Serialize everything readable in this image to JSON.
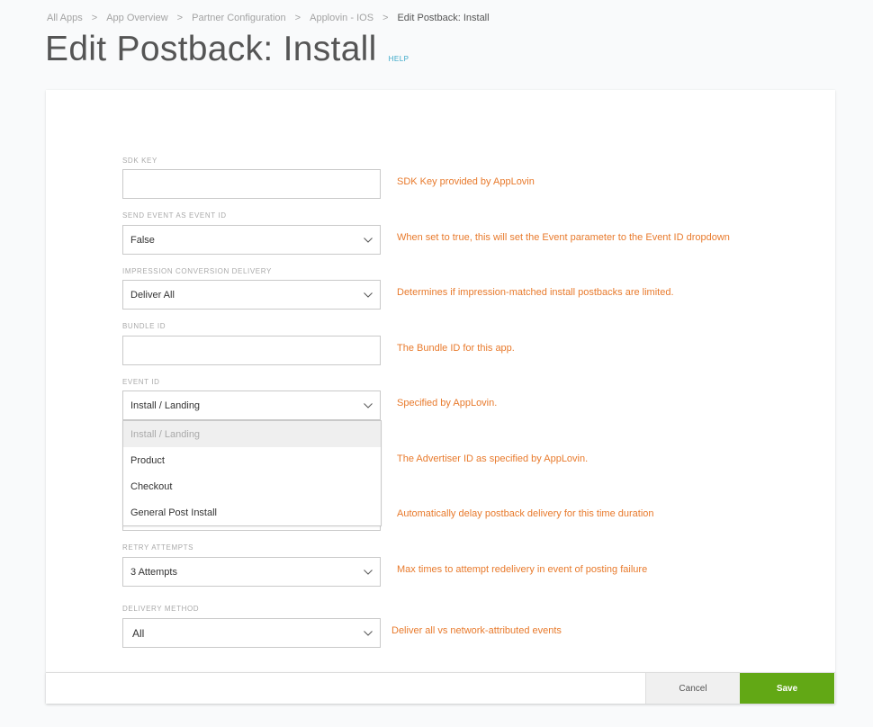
{
  "breadcrumb": [
    {
      "label": "All Apps"
    },
    {
      "label": "App Overview"
    },
    {
      "label": "Partner Configuration"
    },
    {
      "label": "Applovin - IOS"
    },
    {
      "label": "Edit Postback: Install"
    }
  ],
  "breadcrumb_separator": ">",
  "header": {
    "title": "Edit Postback: Install",
    "help_label": "HELP"
  },
  "fields": {
    "sdk_key": {
      "label": "SDK KEY",
      "value": "",
      "hint": "SDK Key provided by AppLovin"
    },
    "send_event_as_event_id": {
      "label": "SEND EVENT AS EVENT ID",
      "value": "False",
      "hint": "When set to true, this will set the Event parameter to the Event ID dropdown"
    },
    "impression_conversion_delivery": {
      "label": "IMPRESSION CONVERSION DELIVERY",
      "value": "Deliver All",
      "hint": "Determines if impression-matched install postbacks are limited."
    },
    "bundle_id": {
      "label": "BUNDLE ID",
      "value": "",
      "hint": "The Bundle ID for this app."
    },
    "event_id": {
      "label": "EVENT ID",
      "value": "Install / Landing",
      "hint": "Specified by AppLovin.",
      "open": true,
      "options": [
        {
          "label": "Install / Landing",
          "selected": true
        },
        {
          "label": "Product",
          "selected": false
        },
        {
          "label": "Checkout",
          "selected": false
        },
        {
          "label": "General Post Install",
          "selected": false
        }
      ]
    },
    "advertiser_id": {
      "hint": "The Advertiser ID as specified by AppLovin."
    },
    "delay": {
      "hint": "Automatically delay postback delivery for this time duration"
    },
    "retry_attempts": {
      "label": "RETRY ATTEMPTS",
      "value": "3 Attempts",
      "hint": "Max times to attempt redelivery in event of posting failure"
    },
    "delivery_method": {
      "label": "DELIVERY METHOD",
      "value": "All",
      "hint": "Deliver all vs network-attributed events"
    }
  },
  "footer": {
    "cancel_label": "Cancel",
    "save_label": "Save"
  },
  "colors": {
    "hint": "#e87a2c",
    "save": "#62a815",
    "help_link": "#3aa8c8"
  }
}
